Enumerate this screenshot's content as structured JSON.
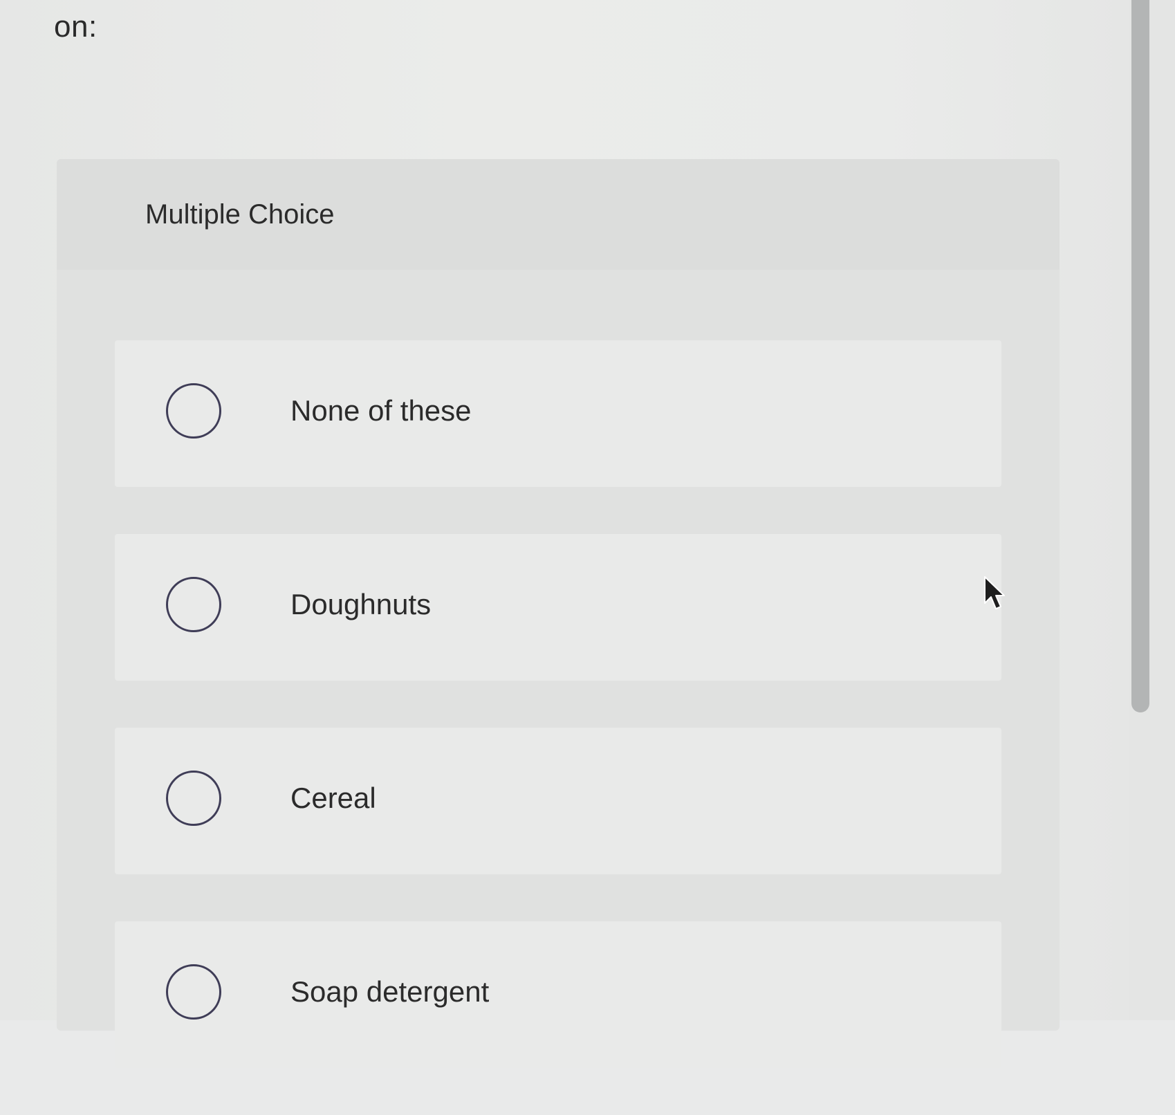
{
  "prompt": {
    "text": "on:"
  },
  "question": {
    "type_label": "Multiple Choice",
    "options": [
      {
        "label": "None of these",
        "selected": false
      },
      {
        "label": "Doughnuts",
        "selected": false
      },
      {
        "label": "Cereal",
        "selected": false
      },
      {
        "label": "Soap detergent",
        "selected": false
      }
    ]
  },
  "colors": {
    "radio_border": "#3f3d57",
    "card_background": "#e0e1e0",
    "option_background": "#e9eae9",
    "scrollbar_thumb": "#b3b5b5"
  },
  "icons": {
    "cursor": "mouse-pointer-icon",
    "radio": "radio-circle-icon"
  }
}
